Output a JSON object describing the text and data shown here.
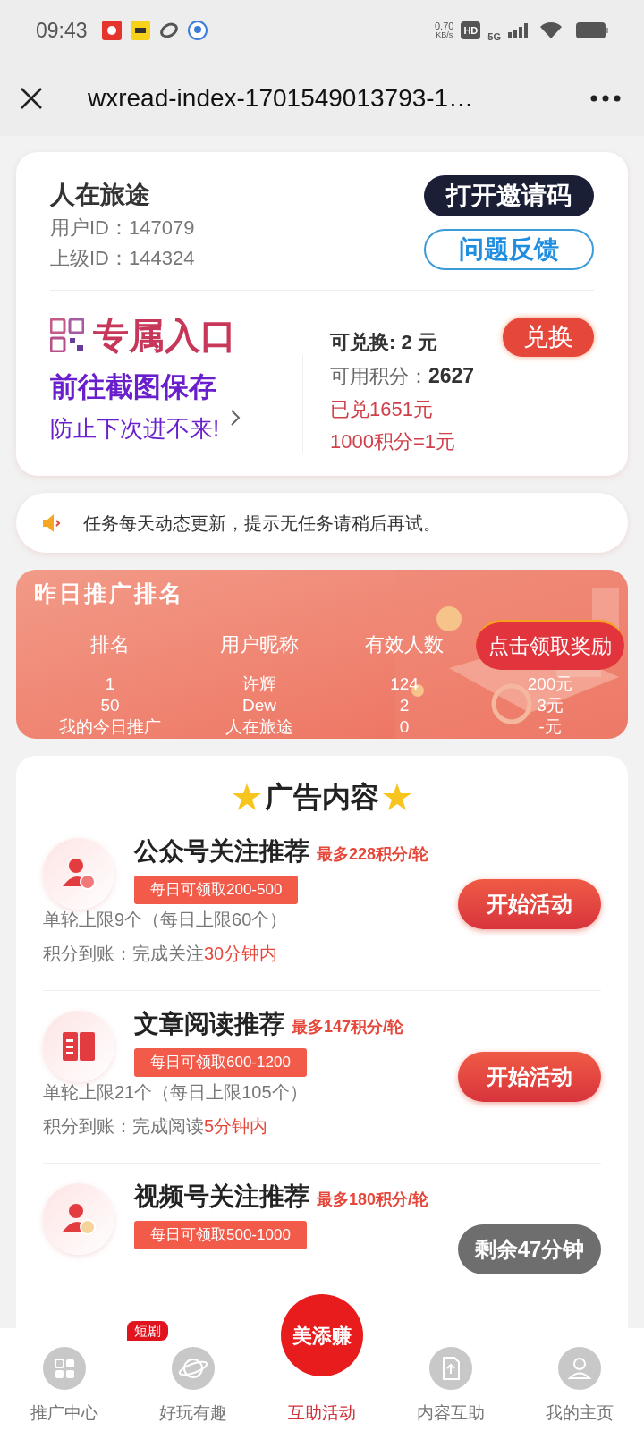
{
  "status_bar": {
    "time": "09:43",
    "speed": "0.70",
    "speed_unit": "KB/s",
    "hd": "HD",
    "network": "5G"
  },
  "nav_bar": {
    "title": "wxread-index-1701549013793-1…"
  },
  "profile": {
    "name": "人在旅途",
    "user_id": "用户ID：147079",
    "parent_id": "上级ID：144324",
    "invite_button": "打开邀请码",
    "feedback_button": "问题反馈"
  },
  "entry": {
    "title": "专属入口",
    "line1": "前往截图保存",
    "line2": "防止下次进不来!"
  },
  "exchange": {
    "available": "可兑换: 2 元",
    "points_label": "可用积分：",
    "points": "2627",
    "redeemed": "已兑1651元",
    "rate": "1000积分=1元",
    "button": "兑换"
  },
  "notice": {
    "text": "任务每天动态更新，提示无任务请稍后再试。"
  },
  "ranking": {
    "title": "昨日推广排名",
    "columns": [
      "排名",
      "用户昵称",
      "有效人数"
    ],
    "claim_button": "点击领取奖励",
    "rows": [
      [
        "1",
        "许辉",
        "124",
        "200元"
      ],
      [
        "50",
        "Dew",
        "2",
        "3元"
      ],
      [
        "我的今日推广",
        "人在旅途",
        "0",
        "-元"
      ]
    ]
  },
  "ads": {
    "title": "广告内容",
    "items": [
      {
        "kind": "follow",
        "title": "公众号关注推荐",
        "max": "最多228积分/轮",
        "quota": "每日可领取200-500",
        "limit": "单轮上限9个（每日上限60个）",
        "arrival_prefix": "积分到账：完成关注",
        "arrival_time": "30分钟内",
        "button": "开始活动",
        "disabled": false
      },
      {
        "kind": "read",
        "title": "文章阅读推荐",
        "max": "最多147积分/轮",
        "quota": "每日可领取600-1200",
        "limit": "单轮上限21个（每日上限105个）",
        "arrival_prefix": "积分到账：完成阅读",
        "arrival_time": "5分钟内",
        "button": "开始活动",
        "disabled": false
      },
      {
        "kind": "video",
        "title": "视频号关注推荐",
        "max": "最多180积分/轮",
        "quota": "每日可领取500-1000",
        "button": "剩余47分钟",
        "disabled": true
      }
    ]
  },
  "tab_bar": {
    "items": [
      {
        "kind": "grid",
        "label": "推广中心",
        "selected": false
      },
      {
        "kind": "planet",
        "label": "好玩有趣",
        "selected": false,
        "badge": "短剧"
      },
      {
        "kind": "logo",
        "label": "互助活动",
        "selected": true,
        "logo": "美添赚"
      },
      {
        "kind": "file",
        "label": "内容互助",
        "selected": false
      },
      {
        "kind": "person",
        "label": "我的主页",
        "selected": false
      }
    ]
  }
}
